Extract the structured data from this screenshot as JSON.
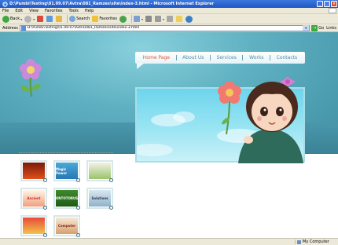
{
  "window": {
    "title": "D:\\Pumbi\\Testing\\01.09.07\\Avtra\\081_Ramzes\\site\\index-3.html - Microsoft Internet Explorer",
    "min_label": "_",
    "max_label": "□",
    "close_label": "×"
  },
  "menu": [
    "File",
    "Edit",
    "View",
    "Favorites",
    "Tools",
    "Help"
  ],
  "toolbar": {
    "back_label": "Back",
    "search_label": "Search",
    "favorites_label": "Favorites"
  },
  "address": {
    "label": "Address",
    "url": "D:\\Pumbi\\Testing\\01.09.07\\Avtra\\081_Ramzes\\site\\index-3.html",
    "go_label": "Go",
    "links_label": "Links"
  },
  "nav": {
    "items": [
      "Home Page",
      "About Us",
      "Services",
      "Works",
      "Contacts"
    ]
  },
  "thumbs": [
    {
      "text": ""
    },
    {
      "text": "Magic Power"
    },
    {
      "text": ""
    },
    {
      "text": "Ancient"
    },
    {
      "text": "ONTOTORUS"
    },
    {
      "text": "Solutions"
    },
    {
      "text": ""
    },
    {
      "text": "Computer"
    }
  ],
  "status": {
    "zone": "My Computer"
  },
  "colors": {
    "nav_active": "#e8542b",
    "nav_normal": "#4b8ea5",
    "hero": "#5fb1c2"
  }
}
